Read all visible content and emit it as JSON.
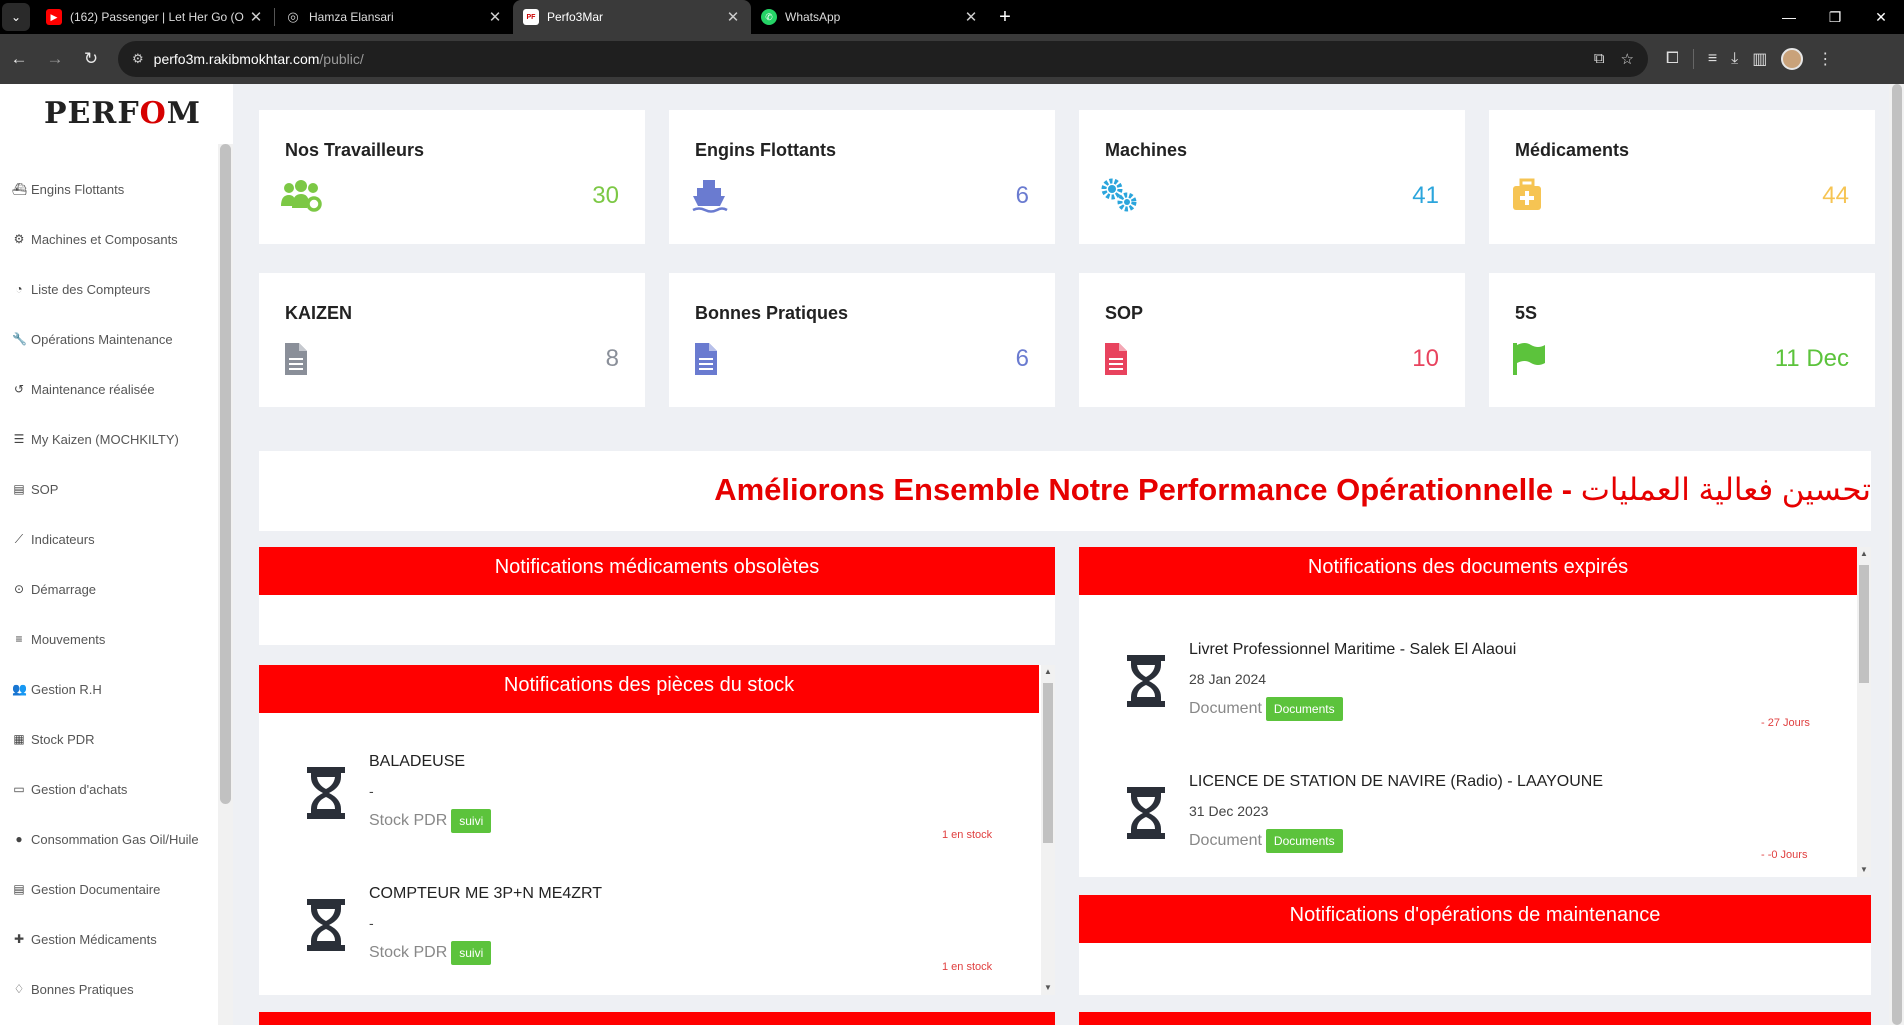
{
  "browser": {
    "tabs": [
      {
        "title": "(162) Passenger | Let Her Go (O",
        "favicon": "youtube-icon",
        "active": false
      },
      {
        "title": "Hamza Elansari",
        "favicon": "globe-icon",
        "active": false
      },
      {
        "title": "Perfo3Mar",
        "favicon": "site-icon",
        "active": true
      },
      {
        "title": "WhatsApp",
        "favicon": "whatsapp-icon",
        "active": false
      }
    ],
    "url_host": "perfo3m.rakibmokhtar.com",
    "url_path": "/public/"
  },
  "sidebar": {
    "logo": "PERFOM",
    "items": [
      {
        "label": "Engins Flottants",
        "icon": "ship-icon"
      },
      {
        "label": "Machines et Composants",
        "icon": "cogs-icon"
      },
      {
        "label": "Liste des Compteurs",
        "icon": "gauge-icon"
      },
      {
        "label": "Opérations Maintenance",
        "icon": "wrench-icon"
      },
      {
        "label": "Maintenance réalisée",
        "icon": "history-icon"
      },
      {
        "label": "My Kaizen (MOCHKILTY)",
        "icon": "list-icon"
      },
      {
        "label": "SOP",
        "icon": "document-icon"
      },
      {
        "label": "Indicateurs",
        "icon": "line-chart-icon"
      },
      {
        "label": "Démarrage",
        "icon": "play-circle-icon"
      },
      {
        "label": "Mouvements",
        "icon": "bars-icon"
      },
      {
        "label": "Gestion R.H",
        "icon": "users-icon"
      },
      {
        "label": "Stock PDR",
        "icon": "archive-icon"
      },
      {
        "label": "Gestion d'achats",
        "icon": "card-icon"
      },
      {
        "label": "Consommation Gas Oil/Huile",
        "icon": "droplet-icon"
      },
      {
        "label": "Gestion Documentaire",
        "icon": "document-icon"
      },
      {
        "label": "Gestion Médicaments",
        "icon": "medkit-icon"
      },
      {
        "label": "Bonnes Pratiques",
        "icon": "lightbulb-icon"
      }
    ]
  },
  "cards": [
    {
      "title": "Nos Travailleurs",
      "value": "30",
      "icon": "users-cog-icon",
      "color": "#7cc845"
    },
    {
      "title": "Engins Flottants",
      "value": "6",
      "icon": "ship-icon",
      "color": "#6a7bd0"
    },
    {
      "title": "Machines",
      "value": "41",
      "icon": "cogs-icon",
      "color": "#2ba5dc"
    },
    {
      "title": "Médicaments",
      "value": "44",
      "icon": "medkit-icon",
      "color": "#f6c453"
    },
    {
      "title": "KAIZEN",
      "value": "8",
      "icon": "file-icon",
      "color": "#8a8f99"
    },
    {
      "title": "Bonnes Pratiques",
      "value": "6",
      "icon": "file-icon",
      "color": "#6a7bd0"
    },
    {
      "title": "SOP",
      "value": "10",
      "icon": "file-icon",
      "color": "#e8435e"
    },
    {
      "title": "5S",
      "value": "11 Dec",
      "icon": "flag-icon",
      "color": "#5cc33c"
    }
  ],
  "banner": {
    "text_fr": "Améliorons Ensemble Notre Performance Opérationnelle - ",
    "text_ar": "تحسين فعالية العمليات"
  },
  "panels": {
    "medicaments": {
      "title": "Notifications médicaments obsolètes"
    },
    "stock": {
      "title": "Notifications des pièces du stock",
      "items": [
        {
          "title": "BALADEUSE",
          "sub": "-",
          "category": "Stock PDR",
          "badge": "suivi",
          "status": "1 en stock"
        },
        {
          "title": "COMPTEUR ME 3P+N ME4ZRT",
          "sub": "-",
          "category": "Stock PDR",
          "badge": "suivi",
          "status": "1 en stock"
        }
      ]
    },
    "documents": {
      "title": "Notifications des documents expirés",
      "items": [
        {
          "title": "Livret Professionnel Maritime - Salek El Alaoui",
          "sub": "28 Jan 2024",
          "category": "Document",
          "badge": "Documents",
          "status": "- 27 Jours"
        },
        {
          "title": "LICENCE DE STATION DE NAVIRE (Radio) - LAAYOUNE",
          "sub": "31 Dec 2023",
          "category": "Document",
          "badge": "Documents",
          "status": "- -0 Jours"
        }
      ]
    },
    "maintenance": {
      "title": "Notifications d'opérations de maintenance"
    }
  }
}
